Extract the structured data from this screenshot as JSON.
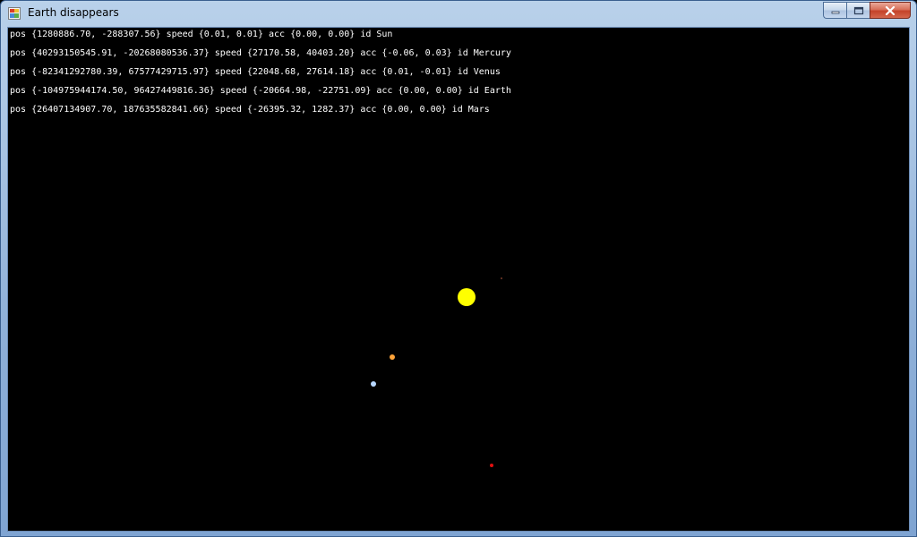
{
  "window": {
    "title": "Earth disappears"
  },
  "caption_buttons": {
    "minimize_icon": "minimize-icon",
    "maximize_icon": "maximize-icon",
    "close_icon": "close-icon"
  },
  "bodies": [
    {
      "id": "Sun",
      "text": "pos {1280886.70, -288307.56} speed {0.01, 0.01} acc {0.00, 0.00} id Sun",
      "color": "#ffff00"
    },
    {
      "id": "Mercury",
      "text": "pos {40293150545.91, -20268080536.37} speed {27170.58, 40403.20} acc {-0.06, 0.03} id Mercury",
      "color": "#7a3b2a"
    },
    {
      "id": "Venus",
      "text": "pos {-82341292780.39, 67577429715.97} speed {22048.68, 27614.18} acc {0.01, -0.01} id Venus",
      "color": "#ffa43a"
    },
    {
      "id": "Earth",
      "text": "pos {-104975944174.50, 96427449816.36} speed {-20664.98, -22751.09} acc {0.00, 0.00} id Earth",
      "color": "#b8d8ff"
    },
    {
      "id": "Mars",
      "text": "pos {26407134907.70, 187635582841.66} speed {-26395.32, 1282.37} acc {0.00, 0.00} id Mars",
      "color": "#e01010"
    }
  ]
}
